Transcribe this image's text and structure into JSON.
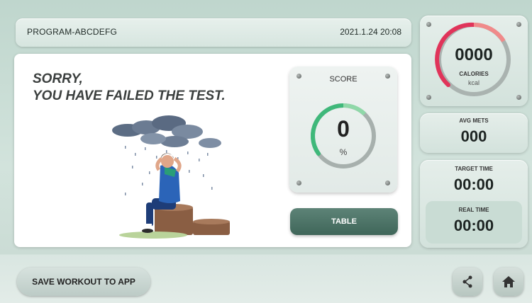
{
  "header": {
    "program": "PROGRAM-ABCDEFG",
    "datetime": "2021.1.24  20:08"
  },
  "result": {
    "line1": "SORRY,",
    "line2": "YOU HAVE FAILED THE TEST."
  },
  "score": {
    "label": "SCORE",
    "value": "0",
    "unit": "%"
  },
  "table_button": "TABLE",
  "calories": {
    "value": "0000",
    "label": "CALORIES",
    "unit": "kcal"
  },
  "avg_mets": {
    "label": "AVG METS",
    "value": "000"
  },
  "target_time": {
    "label": "TARGET TIME",
    "value": "00:00"
  },
  "real_time": {
    "label": "REAL TIME",
    "value": "00:00"
  },
  "footer": {
    "save_label": "SAVE WORKOUT TO APP"
  },
  "icons": {
    "share": "share-icon",
    "home": "home-icon"
  },
  "colors": {
    "accent_green": "#3fb87a",
    "button_dark": "#4a7064",
    "gauge_red": "#e0345a"
  }
}
